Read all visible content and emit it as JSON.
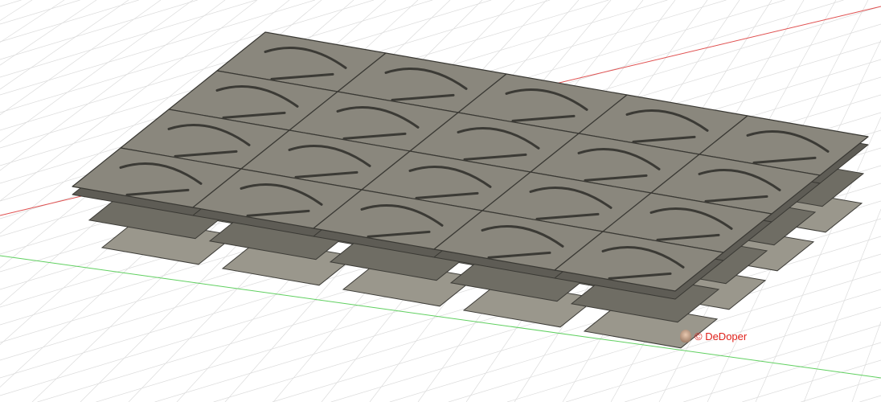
{
  "viewport": {
    "background": "#ffffff",
    "grid_color": "#dcdcdc",
    "x_axis_color": "#e05050",
    "y_axis_color": "#60d060",
    "model_color": "#8a877d",
    "tiles": {
      "rows": 4,
      "cols": 5
    }
  },
  "watermark": {
    "text": "© DeDoper"
  }
}
